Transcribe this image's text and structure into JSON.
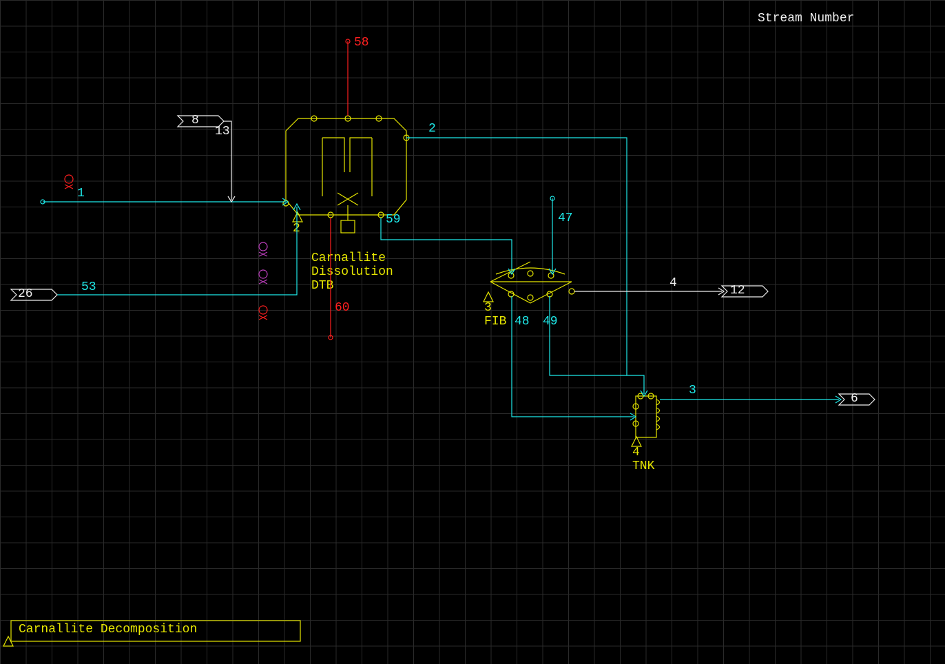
{
  "legend": {
    "title": "Stream Number"
  },
  "title_block": {
    "text": "Carnallite Decomposition"
  },
  "units": {
    "dtb": {
      "id": "2",
      "name_line1": "Carnallite",
      "name_line2": "Dissolution",
      "name_line3": "DTB"
    },
    "fib": {
      "id": "3",
      "name": "FIB"
    },
    "tnk": {
      "id": "4",
      "name": "TNK"
    }
  },
  "arrows": {
    "in_8": "8",
    "in_26": "26",
    "out_12": "12",
    "out_6": "6"
  },
  "streams": {
    "s1": "1",
    "s2_top": "2",
    "s3": "3",
    "s4": "4",
    "s13": "13",
    "s47": "47",
    "s48": "48",
    "s49": "49",
    "s53": "53",
    "s58": "58",
    "s59": "59",
    "s60": "60"
  }
}
